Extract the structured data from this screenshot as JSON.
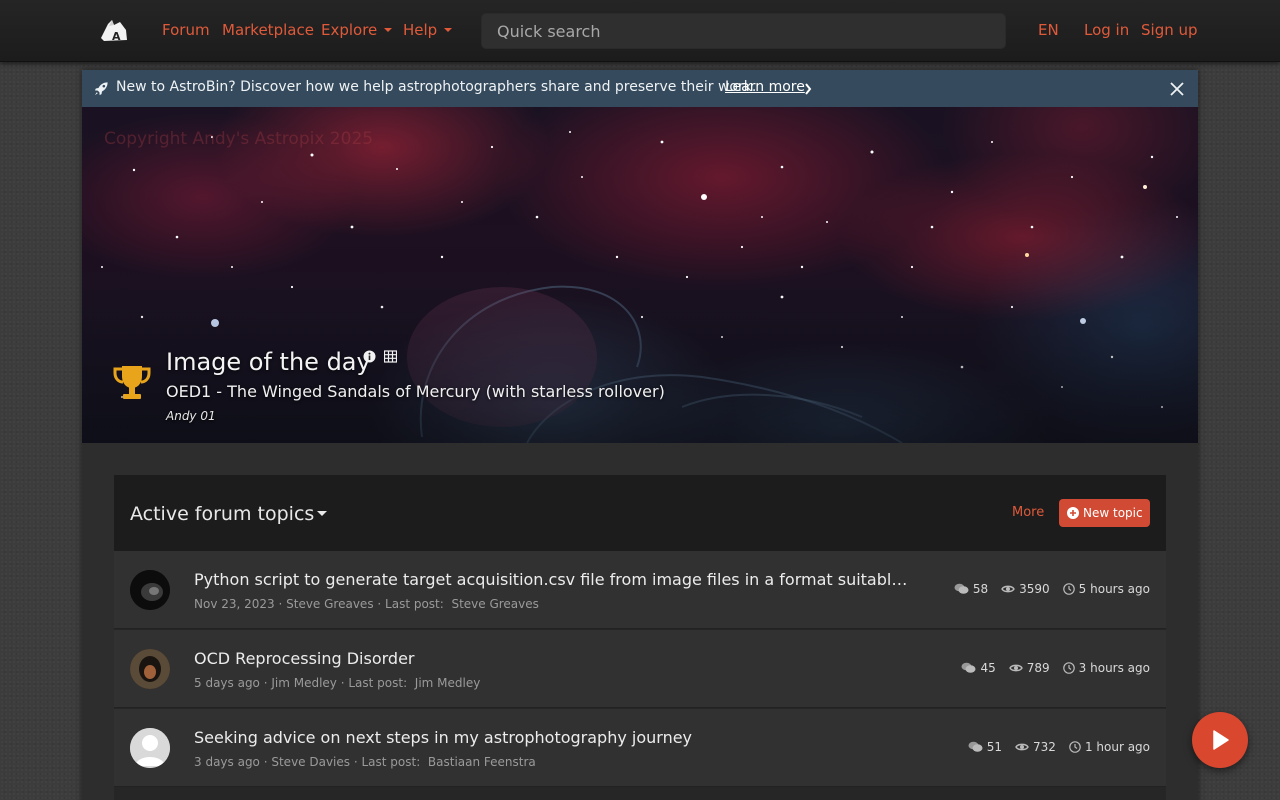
{
  "nav": {
    "items": [
      {
        "label": "Forum",
        "has_caret": false
      },
      {
        "label": "Marketplace",
        "has_caret": false
      },
      {
        "label": "Explore",
        "has_caret": true
      },
      {
        "label": "Help",
        "has_caret": true
      }
    ],
    "search_placeholder": "Quick search",
    "language": "EN",
    "login": "Log in",
    "signup": "Sign up"
  },
  "banner": {
    "message": "New to AstroBin? Discover how we help astrophotographers share and preserve their work.",
    "link": "Learn more"
  },
  "iotd": {
    "heading": "Image of the day",
    "image_title": "OED1 - The Winged Sandals of Mercury (with starless rollover)",
    "author": "Andy 01",
    "watermark": "Copyright Andy's Astropix 2025"
  },
  "forum": {
    "title": "Active forum topics",
    "more": "More",
    "new_topic": "New topic",
    "last_post_label": "Last post:",
    "topics": [
      {
        "title": "Python script to generate target acquisition.csv file from image files in a format suitable for u...",
        "date": "Nov 23, 2023",
        "author": "Steve Greaves",
        "last_post_by": "Steve Greaves",
        "replies": "58",
        "views": "3590",
        "last_activity": "5 hours ago"
      },
      {
        "title": "OCD Reprocessing Disorder",
        "date": "5 days ago",
        "author": "Jim Medley",
        "last_post_by": "Jim Medley",
        "replies": "45",
        "views": "789",
        "last_activity": "3 hours ago"
      },
      {
        "title": "Seeking advice on next steps in my astrophotography journey",
        "date": "3 days ago",
        "author": "Steve Davies",
        "last_post_by": "Bastiaan Feenstra",
        "replies": "51",
        "views": "732",
        "last_activity": "1 hour ago"
      }
    ]
  },
  "colors": {
    "accent": "#e05a3a",
    "banner_bg": "#354a5c",
    "button_bg": "#d14a33"
  },
  "icons": [
    "astrobin-logo-icon",
    "rocket-icon",
    "chevron-right-icon",
    "close-icon",
    "trophy-icon",
    "info-icon",
    "grid-icon",
    "plus-circle-icon",
    "comments-icon",
    "eye-icon",
    "clock-icon",
    "play-icon"
  ]
}
